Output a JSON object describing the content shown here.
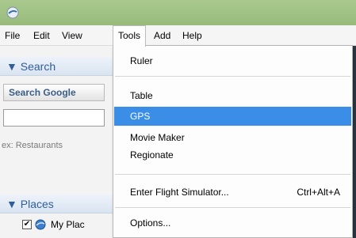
{
  "menubar": {
    "items": [
      "File",
      "Edit",
      "View",
      "Tools",
      "Add",
      "Help"
    ]
  },
  "sidebar": {
    "search_header": "▼ Search",
    "search_button": "Search Google",
    "search_value": "",
    "hint": "ex: Restaurants",
    "places_header": "▼ Places",
    "place_item": {
      "check": "✔",
      "label": "My Plac"
    }
  },
  "tools_menu": {
    "items": [
      {
        "label": "Ruler"
      },
      {
        "label": "Table"
      },
      {
        "label": "GPS",
        "selected": true
      },
      {
        "label": "Movie Maker"
      },
      {
        "label": "Regionate"
      },
      {
        "label": "Enter Flight Simulator...",
        "shortcut": "Ctrl+Alt+A"
      },
      {
        "label": "Options..."
      }
    ]
  },
  "colors": {
    "titlebar": "#a9c98e",
    "selection": "#3a8ee6",
    "panel_text": "#2f5f9a"
  },
  "icons": {
    "app": "earth-app-icon",
    "place": "globe-icon"
  }
}
